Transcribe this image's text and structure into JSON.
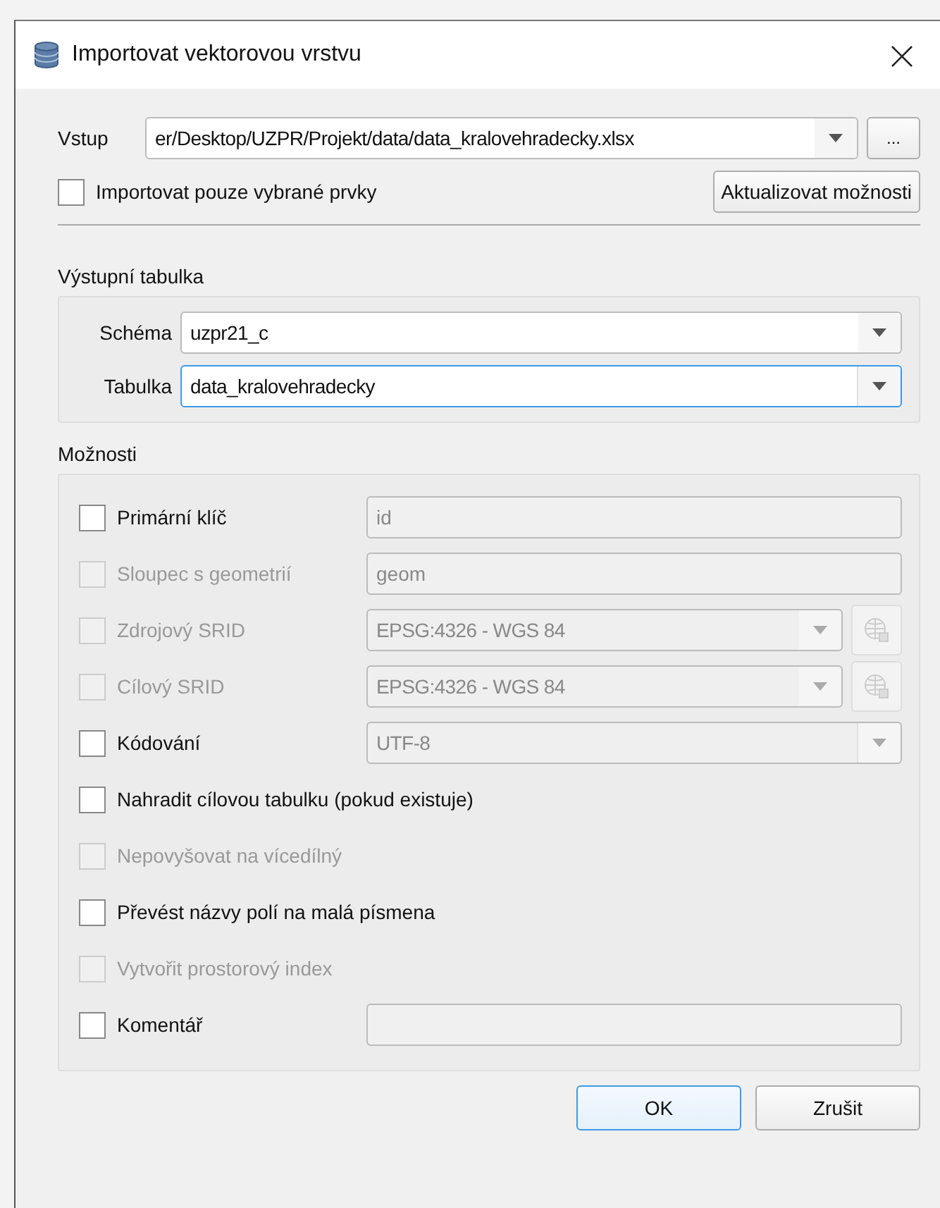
{
  "window": {
    "title": "Importovat vektorovou vrstvu"
  },
  "input": {
    "label": "Vstup",
    "value": "er/Desktop/UZPR/Projekt/data/data_kralovehradecky.xlsx",
    "browse": "..."
  },
  "selected_only": {
    "label": "Importovat pouze vybrané prvky",
    "checked": false
  },
  "refresh_button": "Aktualizovat možnosti",
  "output": {
    "title": "Výstupní tabulka",
    "schema": {
      "label": "Schéma",
      "value": "uzpr21_c",
      "focused": false
    },
    "table": {
      "label": "Tabulka",
      "value": "data_kralovehradecky",
      "focused": true
    }
  },
  "options": {
    "title": "Možnosti",
    "rows": [
      {
        "kind": "field",
        "label": "Primární klíč",
        "checked": false,
        "disabled": false,
        "value": "id"
      },
      {
        "kind": "field",
        "label": "Sloupec s geometrií",
        "checked": false,
        "disabled": true,
        "value": "geom"
      },
      {
        "kind": "crs",
        "label": "Zdrojový SRID",
        "checked": false,
        "disabled": true,
        "value": "EPSG:4326 - WGS 84"
      },
      {
        "kind": "crs",
        "label": "Cílový SRID",
        "checked": false,
        "disabled": true,
        "value": "EPSG:4326 - WGS 84"
      },
      {
        "kind": "combo",
        "label": "Kódování",
        "checked": false,
        "disabled": false,
        "value": "UTF-8"
      },
      {
        "kind": "check",
        "label": "Nahradit cílovou tabulku (pokud existuje)",
        "checked": false,
        "disabled": false
      },
      {
        "kind": "check",
        "label": "Nepovyšovat na vícedílný",
        "checked": false,
        "disabled": true
      },
      {
        "kind": "check",
        "label": "Převést názvy polí na malá písmena",
        "checked": false,
        "disabled": false
      },
      {
        "kind": "check",
        "label": "Vytvořit prostorový index",
        "checked": false,
        "disabled": true
      },
      {
        "kind": "field",
        "label": "Komentář",
        "checked": false,
        "disabled": false
      }
    ]
  },
  "buttons": [
    {
      "label": "OK",
      "default": true
    },
    {
      "label": "Zrušit",
      "default": false
    }
  ]
}
